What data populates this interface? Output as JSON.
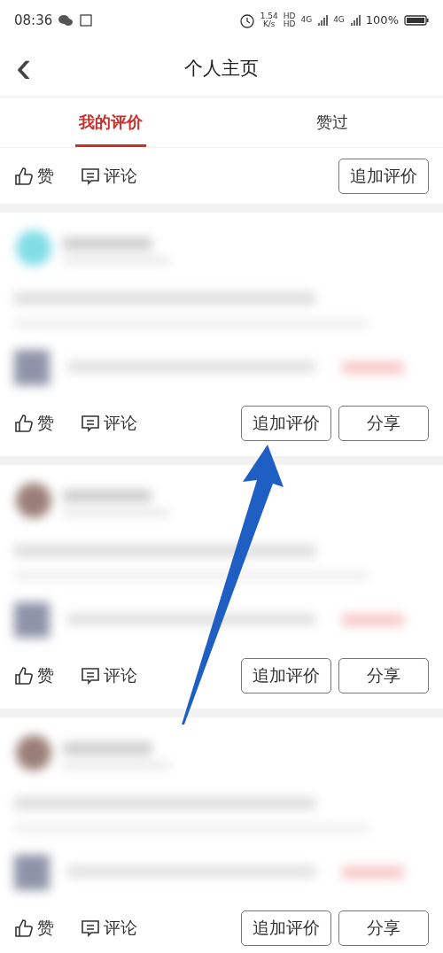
{
  "status_bar": {
    "time": "08:36",
    "speed": "1.54",
    "speed_unit": "K/s",
    "hd": [
      "HD",
      "HD"
    ],
    "networks": [
      "4G",
      "4G"
    ],
    "battery": "100%"
  },
  "header": {
    "back": "‹",
    "title": "个人主页"
  },
  "tabs": [
    {
      "label": "我的评价",
      "selected": true
    },
    {
      "label": "赞过",
      "selected": false
    }
  ],
  "cards": [
    {
      "partial": true,
      "like": "赞",
      "comment": "评论",
      "buttons": [
        "追加评价"
      ]
    },
    {
      "partial": false,
      "color": "#7fdde6",
      "like": "赞",
      "comment": "评论",
      "buttons": [
        "追加评价",
        "分享"
      ]
    },
    {
      "partial": false,
      "color": "#9a7f78",
      "like": "赞",
      "comment": "评论",
      "buttons": [
        "追加评价",
        "分享"
      ]
    },
    {
      "partial": false,
      "color": "#9a7f78",
      "like": "赞",
      "comment": "评论",
      "buttons": [
        "追加评价",
        "分享"
      ]
    }
  ],
  "annotation": {
    "kind": "arrow",
    "color": "#1f5fc4"
  }
}
